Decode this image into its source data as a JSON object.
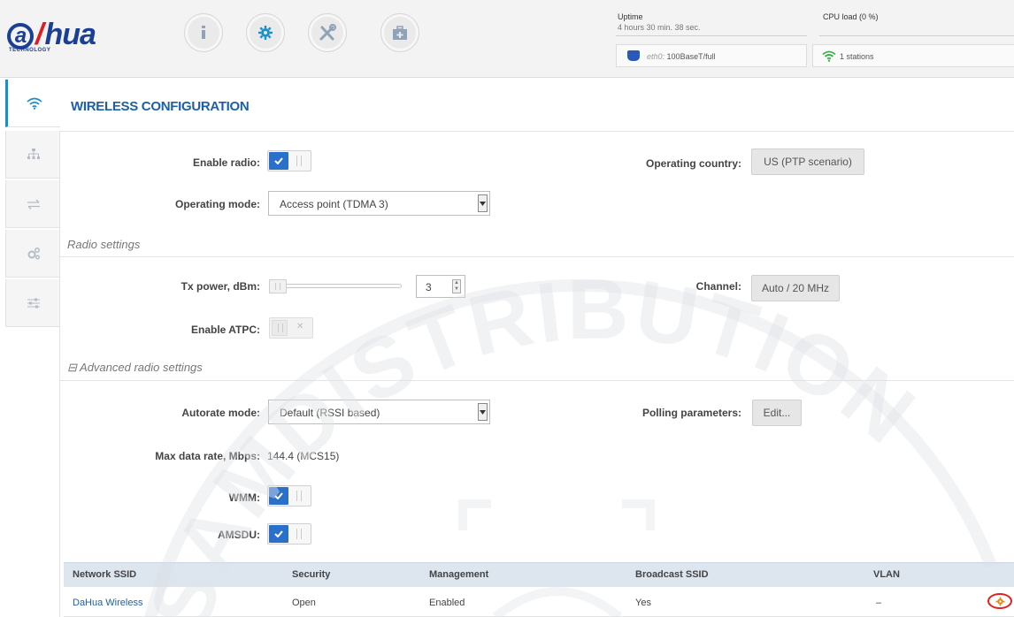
{
  "brand": {
    "logo_text": "alhua",
    "logo_subtext": "TECHNOLOGY"
  },
  "header": {
    "nav_icons": [
      "info-icon",
      "gear-icon",
      "tools-icon",
      "first-aid-kit-icon"
    ],
    "uptime_label": "Uptime",
    "uptime_value": "4 hours 30 min. 38 sec.",
    "cpu_label": "CPU load (0 %)",
    "cpu_load_percent": 0,
    "eth_iface": "eth0:",
    "eth_value": "100BaseT/full",
    "stations": "1 stations"
  },
  "sidebar": {
    "items": [
      {
        "icon": "wifi-icon",
        "active": true
      },
      {
        "icon": "network-tree-icon",
        "active": false
      },
      {
        "icon": "arrows-exchange-icon",
        "active": false
      },
      {
        "icon": "gears-icon",
        "active": false
      },
      {
        "icon": "sliders-icon",
        "active": false
      }
    ]
  },
  "page": {
    "title": "WIRELESS CONFIGURATION"
  },
  "form": {
    "enable_radio_label": "Enable radio:",
    "enable_radio_on": true,
    "operating_country_label": "Operating country:",
    "operating_country_value": "US (PTP scenario)",
    "operating_mode_label": "Operating mode:",
    "operating_mode_value": "Access point (TDMA 3)",
    "radio_settings_title": "Radio settings",
    "tx_power_label": "Tx power, dBm:",
    "tx_power_value": "3",
    "channel_label": "Channel:",
    "channel_value": "Auto / 20 MHz",
    "enable_atpc_label": "Enable ATPC:",
    "enable_atpc_on": false,
    "advanced_title": "⊟ Advanced radio settings",
    "autorate_label": "Autorate mode:",
    "autorate_value": "Default (RSSI based)",
    "polling_label": "Polling parameters:",
    "polling_button": "Edit...",
    "max_rate_label": "Max data rate, Mbps:",
    "max_rate_value": "144.4 (MCS15)",
    "wmm_label": "WMM:",
    "wmm_on": true,
    "amsdu_label": "AMSDU:",
    "amsdu_on": true
  },
  "table": {
    "headers": [
      "Network SSID",
      "Security",
      "Management",
      "Broadcast SSID",
      "VLAN"
    ],
    "rows": [
      {
        "ssid": "DaHua Wireless",
        "security": "Open",
        "management": "Enabled",
        "broadcast": "Yes",
        "vlan": "–"
      }
    ]
  },
  "watermark": {
    "text": "SAMDISTRIBUTION"
  },
  "colors": {
    "accent": "#1d5fa8",
    "toggle_on": "#2a6fc9",
    "highlight_circle": "#e0231f"
  }
}
